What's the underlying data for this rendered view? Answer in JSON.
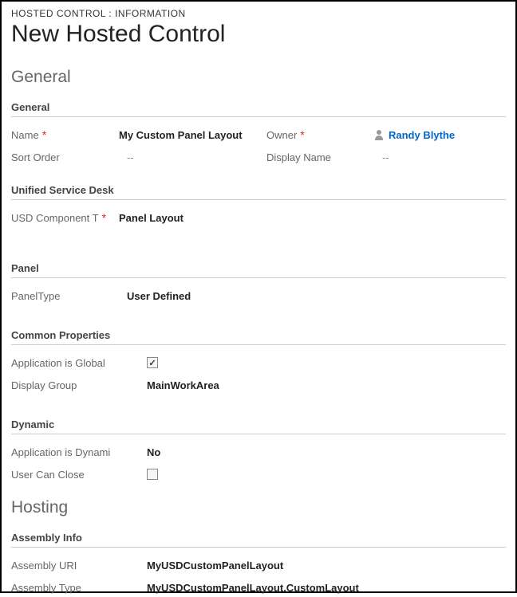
{
  "breadcrumb": "HOSTED CONTROL : INFORMATION",
  "page_title": "New Hosted Control",
  "sections": {
    "general": {
      "heading": "General",
      "groups": {
        "general": {
          "heading": "General",
          "name_label": "Name",
          "name_value": "My Custom Panel Layout",
          "owner_label": "Owner",
          "owner_value": "Randy Blythe",
          "sort_order_label": "Sort Order",
          "sort_order_value": "--",
          "display_name_label": "Display Name",
          "display_name_value": "--"
        },
        "usd": {
          "heading": "Unified Service Desk",
          "component_label": "USD Component T",
          "component_value": "Panel Layout"
        },
        "panel": {
          "heading": "Panel",
          "panel_type_label": "PanelType",
          "panel_type_value": "User Defined"
        },
        "common": {
          "heading": "Common Properties",
          "app_global_label": "Application is Global",
          "app_global_checked": "true",
          "display_group_label": "Display Group",
          "display_group_value": "MainWorkArea"
        },
        "dynamic": {
          "heading": "Dynamic",
          "app_dynamic_label": "Application is Dynami",
          "app_dynamic_value": "No",
          "user_close_label": "User Can Close",
          "user_close_checked": "false"
        }
      }
    },
    "hosting": {
      "heading": "Hosting",
      "groups": {
        "assembly": {
          "heading": "Assembly Info",
          "uri_label": "Assembly URI",
          "uri_value": "MyUSDCustomPanelLayout",
          "type_label": "Assembly Type",
          "type_value": "MyUSDCustomPanelLayout.CustomLayout"
        }
      }
    }
  }
}
